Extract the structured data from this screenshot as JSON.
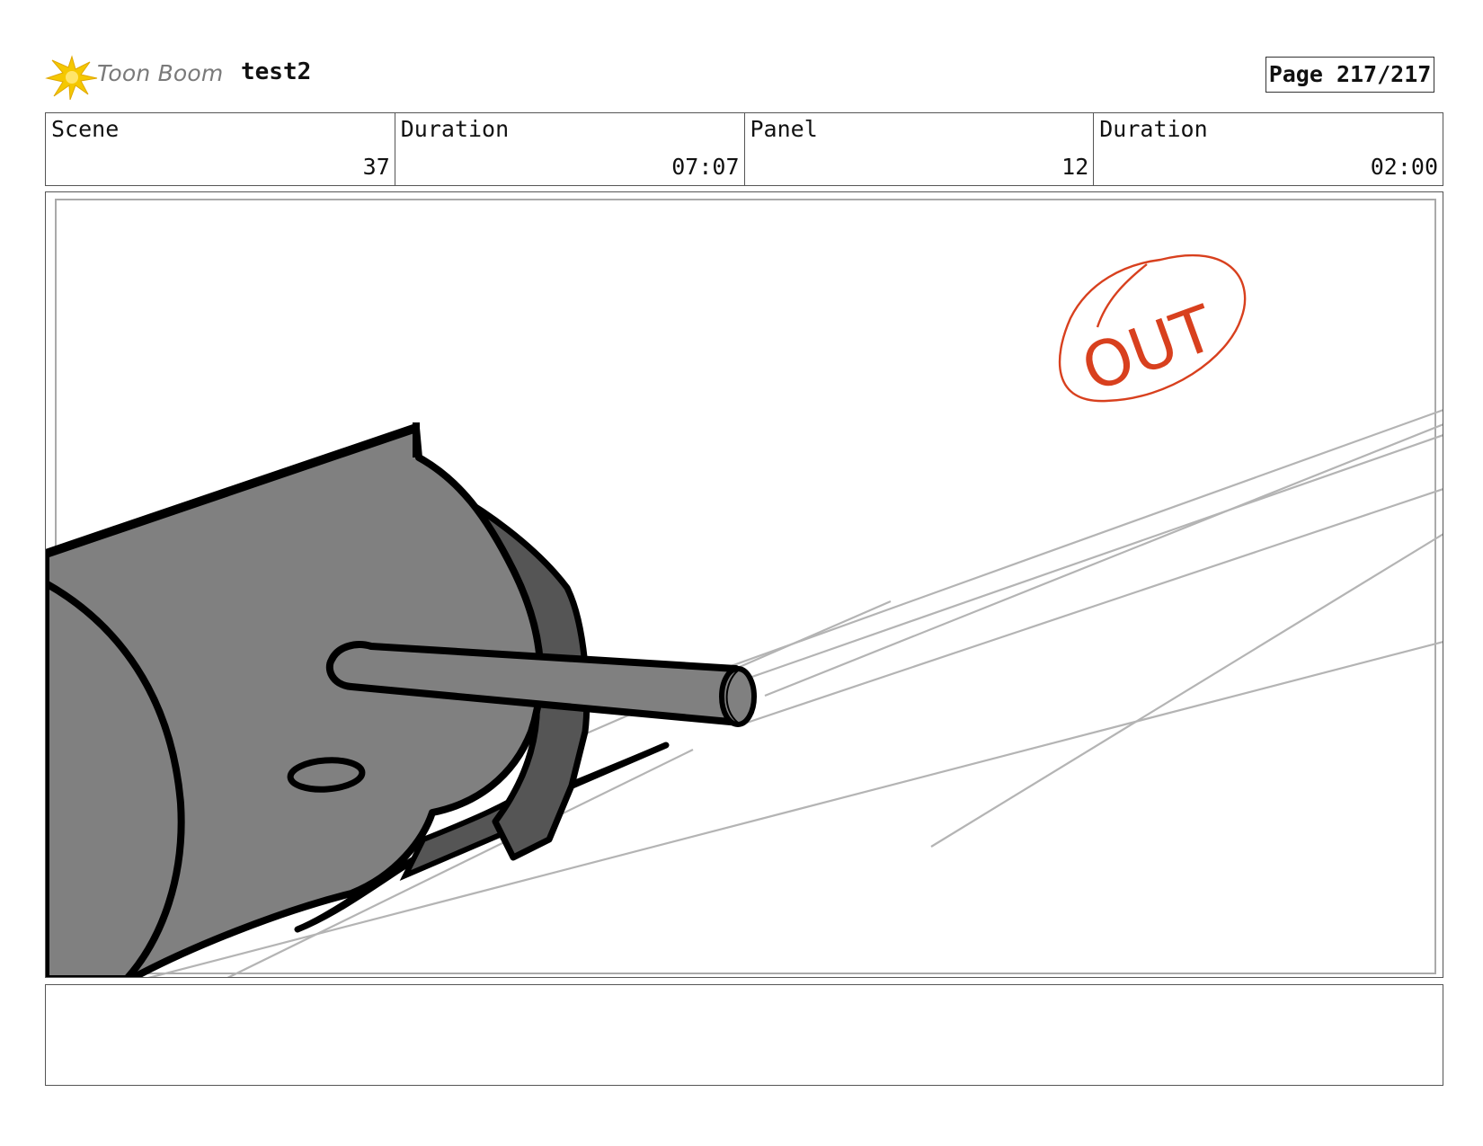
{
  "header": {
    "logo_text": "Toon Boom",
    "project_title": "test2",
    "page_label": "Page 217/217"
  },
  "info": [
    {
      "label": "Scene",
      "value": "37"
    },
    {
      "label": "Duration",
      "value": "07:07"
    },
    {
      "label": "Panel",
      "value": "12"
    },
    {
      "label": "Duration",
      "value": "02:00"
    }
  ],
  "panel": {
    "annotation_text": "OUT",
    "colors": {
      "annotation": "#d8401e",
      "sketch_lines": "#b4b4b4",
      "body_fill": "#808080",
      "shadow_fill": "#555555",
      "outline": "#000000",
      "logo_yellow": "#f5c800"
    }
  },
  "caption": {
    "text": ""
  }
}
